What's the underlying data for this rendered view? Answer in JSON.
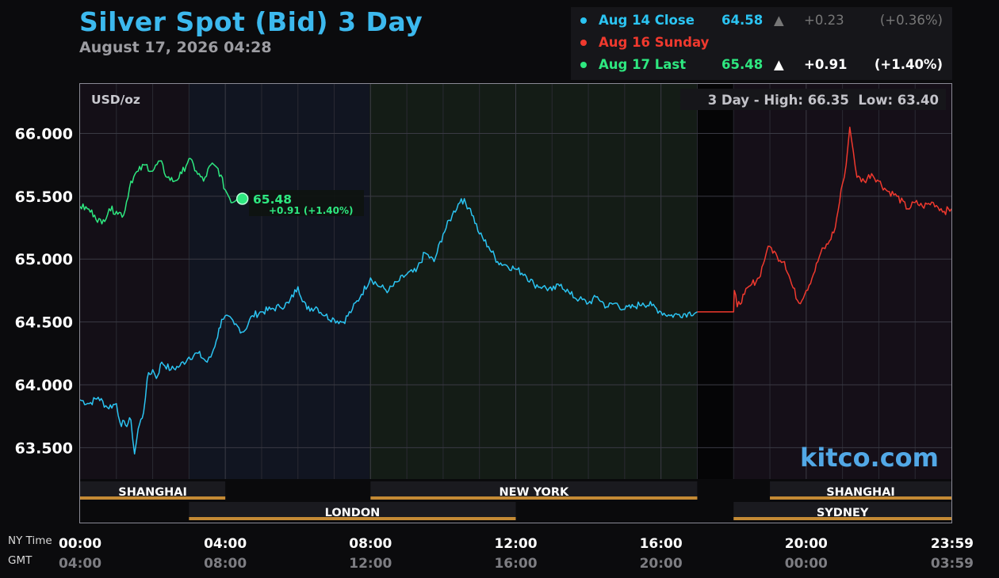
{
  "header": {
    "title": "Silver Spot (Bid) 3 Day",
    "datetime": "August 17, 2026 04:28"
  },
  "legend": [
    {
      "label": "Aug 14 Close",
      "value": "64.58",
      "arrow": "▲",
      "change": "+0.23",
      "pct": "(+0.36%)",
      "color": "#2bc4f2",
      "muted": true
    },
    {
      "label": "Aug 16 Sunday",
      "value": "",
      "arrow": "",
      "change": "",
      "pct": "",
      "color": "#f0392e",
      "muted": false
    },
    {
      "label": "Aug 17 Last",
      "value": "65.48",
      "arrow": "▲",
      "change": "+0.91",
      "pct": "(+1.40%)",
      "color": "#2ee880",
      "muted": false
    }
  ],
  "chart": {
    "unit": "USD/oz",
    "range_text": "3 Day - High: 66.35  Low: 63.40",
    "watermark": "kitco.com",
    "last_label": {
      "value": "65.48",
      "change": "+0.91 (+1.40%)"
    }
  },
  "time_axis": {
    "ny_label": "NY Time",
    "gmt_label": "GMT"
  },
  "chart_data": {
    "type": "line",
    "title": "Silver Spot (Bid) 3 Day",
    "ylabel": "USD/oz",
    "ylim": [
      63.25,
      66.4
    ],
    "xlim": [
      0,
      24
    ],
    "yticks": [
      63.5,
      64.0,
      64.5,
      65.0,
      65.5,
      66.0
    ],
    "ytick_labels": [
      "63.500",
      "64.000",
      "64.500",
      "65.000",
      "65.500",
      "66.000"
    ],
    "xticks": [
      0,
      4,
      8,
      12,
      16,
      20,
      23.98
    ],
    "xtick_labels_ny": [
      "00:00",
      "04:00",
      "08:00",
      "12:00",
      "16:00",
      "20:00",
      "23:59"
    ],
    "xtick_labels_gmt": [
      "04:00",
      "08:00",
      "12:00",
      "16:00",
      "20:00",
      "00:00",
      "03:59"
    ],
    "grid": true,
    "legend_position": "top-right",
    "high": 66.35,
    "low": 63.4,
    "sessions": [
      {
        "name": "SHANGHAI",
        "start": 0,
        "end": 4,
        "row": 0
      },
      {
        "name": "NEW YORK",
        "start": 8,
        "end": 17,
        "row": 0
      },
      {
        "name": "SHANGHAI",
        "start": 19,
        "end": 24,
        "row": 0
      },
      {
        "name": "LONDON",
        "start": 3,
        "end": 12,
        "row": 1
      },
      {
        "name": "SYDNEY",
        "start": 18,
        "end": 24,
        "row": 1
      }
    ],
    "series": [
      {
        "name": "Aug 14 Close",
        "color": "#2bc4f2",
        "x": [
          0,
          0.25,
          0.5,
          0.75,
          1.0,
          1.1,
          1.25,
          1.4,
          1.5,
          1.6,
          1.75,
          1.85,
          2.0,
          2.1,
          2.25,
          2.5,
          2.75,
          3.0,
          3.25,
          3.5,
          3.6,
          3.75,
          3.9,
          4.0,
          4.25,
          4.5,
          4.75,
          5.0,
          5.25,
          5.5,
          5.75,
          6.0,
          6.25,
          6.5,
          6.75,
          7.0,
          7.25,
          7.5,
          7.75,
          8.0,
          8.25,
          8.5,
          8.75,
          9.0,
          9.25,
          9.5,
          9.75,
          10.0,
          10.25,
          10.5,
          10.75,
          11.0,
          11.25,
          11.5,
          11.75,
          12.0,
          12.25,
          12.5,
          12.75,
          13.0,
          13.25,
          13.5,
          13.75,
          14.0,
          14.25,
          14.5,
          14.75,
          15.0,
          15.25,
          15.5,
          15.75,
          16.0,
          16.25,
          16.5,
          16.75,
          17.0
        ],
        "values": [
          63.88,
          63.85,
          63.9,
          63.82,
          63.85,
          63.7,
          63.68,
          63.72,
          63.45,
          63.65,
          63.78,
          64.05,
          64.12,
          64.05,
          64.18,
          64.12,
          64.15,
          64.22,
          64.25,
          64.18,
          64.22,
          64.35,
          64.52,
          64.55,
          64.48,
          64.42,
          64.55,
          64.58,
          64.6,
          64.62,
          64.65,
          64.78,
          64.6,
          64.62,
          64.55,
          64.52,
          64.5,
          64.6,
          64.72,
          64.85,
          64.78,
          64.75,
          64.82,
          64.88,
          64.9,
          65.05,
          64.98,
          65.2,
          65.35,
          65.48,
          65.4,
          65.2,
          65.1,
          64.98,
          64.95,
          64.92,
          64.88,
          64.8,
          64.78,
          64.75,
          64.8,
          64.72,
          64.68,
          64.65,
          64.7,
          64.62,
          64.65,
          64.6,
          64.62,
          64.65,
          64.63,
          64.58,
          64.55,
          64.56,
          64.57,
          64.58
        ]
      },
      {
        "name": "Aug 16 Sunday",
        "color": "#f0392e",
        "x": [
          17.0,
          18.0,
          18.02,
          18.1,
          18.3,
          18.5,
          18.7,
          18.9,
          19.0,
          19.2,
          19.4,
          19.6,
          19.8,
          20.0,
          20.2,
          20.4,
          20.6,
          20.8,
          21.0,
          21.1,
          21.2,
          21.3,
          21.4,
          21.6,
          21.8,
          22.0,
          22.2,
          22.5,
          22.8,
          23.0,
          23.2,
          23.5,
          23.8,
          24.0
        ],
        "values": [
          64.58,
          64.58,
          64.75,
          64.62,
          64.72,
          64.8,
          64.85,
          65.05,
          65.1,
          65.02,
          64.98,
          64.8,
          64.65,
          64.75,
          64.88,
          65.05,
          65.12,
          65.25,
          65.6,
          65.75,
          66.05,
          65.85,
          65.65,
          65.62,
          65.68,
          65.62,
          65.55,
          65.5,
          65.4,
          65.45,
          65.42,
          65.45,
          65.38,
          65.4
        ]
      },
      {
        "name": "Aug 17 Last",
        "color": "#2ee880",
        "x": [
          0,
          0.2,
          0.4,
          0.6,
          0.8,
          1.0,
          1.2,
          1.4,
          1.6,
          1.8,
          2.0,
          2.2,
          2.4,
          2.6,
          2.8,
          3.0,
          3.2,
          3.4,
          3.6,
          3.8,
          4.0,
          4.2,
          4.4,
          4.47
        ],
        "values": [
          65.42,
          65.4,
          65.35,
          65.28,
          65.4,
          65.38,
          65.35,
          65.62,
          65.7,
          65.75,
          65.7,
          65.78,
          65.65,
          65.62,
          65.68,
          65.8,
          65.7,
          65.62,
          65.75,
          65.72,
          65.55,
          65.45,
          65.52,
          65.48
        ]
      }
    ]
  }
}
